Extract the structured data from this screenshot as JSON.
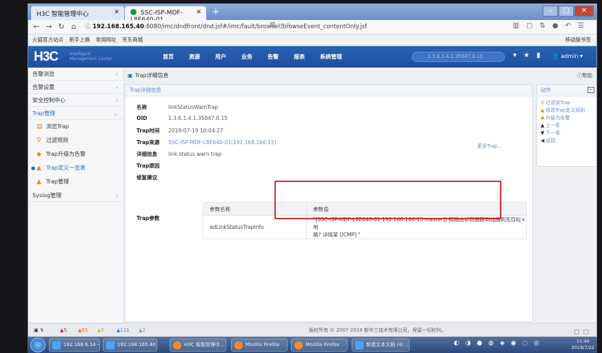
{
  "browser": {
    "tabs": [
      {
        "label": "H3C 智能管理中心"
      },
      {
        "label": "SSC-ISP-MDF-L8E640-01"
      }
    ],
    "url_host": "192.168.165.40",
    "url_path": ":8080/imc/dndfront/dnd.jsf#/imc/fault/browser/browseEvent_contentOnly.jsf",
    "url_tools": "▥ ··· ☆",
    "bookmarks": [
      "火狐官方站点",
      "新手上路",
      "常用网址",
      "京东商城"
    ],
    "mobile_bookmarks": "移动版书签"
  },
  "app": {
    "logo": "H3C",
    "logo_sub_1": "Intelligent",
    "logo_sub_2": "Management Center",
    "menu": [
      "首页",
      "资源",
      "用户",
      "业务",
      "告警",
      "报表",
      "系统管理"
    ],
    "search_placeholder": "1.3.6.1.4.1.35047.0.15",
    "admin_label": "admin"
  },
  "sidebar": {
    "items": [
      {
        "label": "告警浏览"
      },
      {
        "label": "告警设置"
      },
      {
        "label": "安全控制中心"
      },
      {
        "label": "Trap管理"
      }
    ],
    "subitems": [
      {
        "label": "浏览Trap"
      },
      {
        "label": "过滤规则"
      },
      {
        "label": "Trap升级为告警"
      },
      {
        "label": "Trap定义一览表"
      },
      {
        "label": "Trap管理"
      }
    ],
    "syslog": "Syslog管理"
  },
  "page": {
    "title": "Trap详细信息",
    "help": "帮助",
    "panel_title": "Trap详细信息",
    "fields": [
      {
        "key": "名称",
        "value": "linkStatusWarnTrap"
      },
      {
        "key": "OID",
        "value": "1.3.6.1.4.1.35047.0.15"
      },
      {
        "key": "Trap时间",
        "value": "2019-07-19 10:04:27"
      },
      {
        "key": "Trap来源",
        "value": "SSC-ISP-MDF-L8E640-01(192.168.166.15)"
      },
      {
        "key": "详细信息",
        "value": "link status warn trap"
      },
      {
        "key": "Trap原因",
        "value": ""
      },
      {
        "key": "修复建议",
        "value": ""
      }
    ],
    "more_trap": "更多Trap...",
    "param_label": "Trap参数",
    "param_table": {
      "headers": [
        "参数名称",
        "参数值"
      ],
      "row": {
        "name": "adLinkStatusTrapInfo",
        "value_line1": "\"[SSC-ISP-MDF-L8E640-01 192.168.166.15 master]] 链路由状态跟踪到线路到无目标×地",
        "value_line2": "路? 详情某 [ICMP] \""
      }
    }
  },
  "actions": {
    "title": "动作",
    "items": [
      {
        "label": "过滤该Trap",
        "icon": "filter-icon"
      },
      {
        "label": "修改Trap定义规则",
        "icon": "edit-icon"
      },
      {
        "label": "升级为告警",
        "icon": "upgrade-icon"
      },
      {
        "label": "上一条",
        "icon": "arrow-up-icon"
      },
      {
        "label": "下一条",
        "icon": "arrow-down-icon"
      },
      {
        "label": "返回",
        "icon": "back-icon"
      }
    ]
  },
  "statusbar": {
    "counts": [
      "5",
      "65",
      "6",
      "111",
      "2"
    ],
    "copyright": "版权所有 © 2007-2018 新华三技术有限公司，保留一切权利。"
  },
  "taskbar": {
    "items": [
      {
        "label": "192.168.6.14 - ..."
      },
      {
        "label": "192.168.165.40 - ..."
      },
      {
        "label": "H3C 智能管理中..."
      },
      {
        "label": "Mozilla Firefox"
      },
      {
        "label": "Mozilla Firefox"
      },
      {
        "label": "新建文本文档 (4) ..."
      }
    ],
    "time": "11:40",
    "date": "2019/7/22"
  },
  "colors": {
    "accent": "#2a68b8",
    "header": "#1d4e9d",
    "highlight": "#d42b2b"
  }
}
